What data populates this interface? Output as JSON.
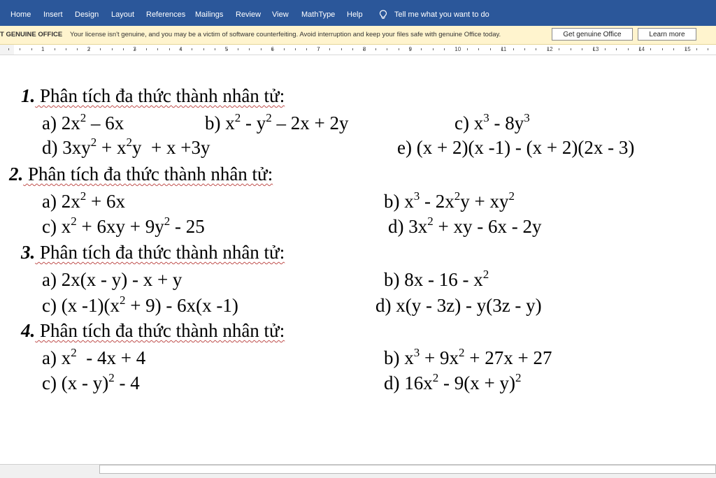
{
  "ribbon": {
    "tabs": [
      "Home",
      "Insert",
      "Design",
      "Layout",
      "References",
      "Mailings",
      "Review",
      "View",
      "MathType",
      "Help"
    ],
    "tell_me": "Tell me what you want to do"
  },
  "license_bar": {
    "title": "T GENUINE OFFICE",
    "message": "Your license isn't genuine, and you may be a victim of software counterfeiting. Avoid interruption and keep your files safe with genuine Office today.",
    "get_button": "Get genuine Office",
    "learn_button": "Learn more"
  },
  "ruler": {
    "numbers": [
      "1",
      "2",
      "3",
      "4",
      "5",
      "6",
      "7",
      "8",
      "9",
      "10",
      "11",
      "12",
      "13",
      "14",
      "15"
    ]
  },
  "document": {
    "sections": [
      {
        "number": "1.",
        "title": "Phân tích đa thức thành nhân tử:",
        "items": [
          {
            "label": "a)",
            "expr": "2x<sup>2</sup> – 6x"
          },
          {
            "label": "b)",
            "expr": "x<sup>2</sup> - y<sup>2</sup> – 2x + 2y"
          },
          {
            "label": "c)",
            "expr": "x<sup>3</sup> - 8y<sup>3</sup>"
          },
          {
            "label": "d)",
            "expr": "3xy<sup>2</sup> + x<sup>2</sup>y &nbsp;+ x +3y"
          },
          {
            "label": "e)",
            "expr": "(x + 2)(x -1) - (x + 2)(2x - 3)"
          }
        ]
      },
      {
        "number": "2.",
        "title": "Phân tích đa thức thành nhân tử:",
        "items": [
          {
            "label": "a)",
            "expr": "2x<sup>2</sup> + 6x"
          },
          {
            "label": "b)",
            "expr": "x<sup>3</sup> - 2x<sup>2</sup>y + xy<sup>2</sup>"
          },
          {
            "label": "c)",
            "expr": "x<sup>2</sup> + 6xy + 9y<sup>2</sup> - 25"
          },
          {
            "label": "d)",
            "expr": "3x<sup>2</sup> + xy - 6x - 2y"
          }
        ]
      },
      {
        "number": "3.",
        "title": "Phân tích đa thức thành nhân tử:",
        "items": [
          {
            "label": "a)",
            "expr": "2x(x - y) - x + y"
          },
          {
            "label": "b)",
            "expr": "8x - 16 - x<sup>2</sup>"
          },
          {
            "label": "c)",
            "expr": "(x -1)(x<sup>2</sup> + 9) - 6x(x -1)"
          },
          {
            "label": "d)",
            "expr": "x(y - 3z) - y(3z - y)"
          }
        ]
      },
      {
        "number": "4.",
        "title": "Phân tích đa thức thành nhân tử:",
        "items": [
          {
            "label": "a)",
            "expr": "x<sup>2</sup> &nbsp;- 4x + 4"
          },
          {
            "label": "b)",
            "expr": "x<sup>3</sup> + 9x<sup>2</sup> + 27x + 27"
          },
          {
            "label": "c)",
            "expr": "(x - y)<sup>2</sup> - 4"
          },
          {
            "label": "d)",
            "expr": "16x<sup>2</sup> - 9(x + y)<sup>2</sup>"
          }
        ]
      }
    ]
  }
}
